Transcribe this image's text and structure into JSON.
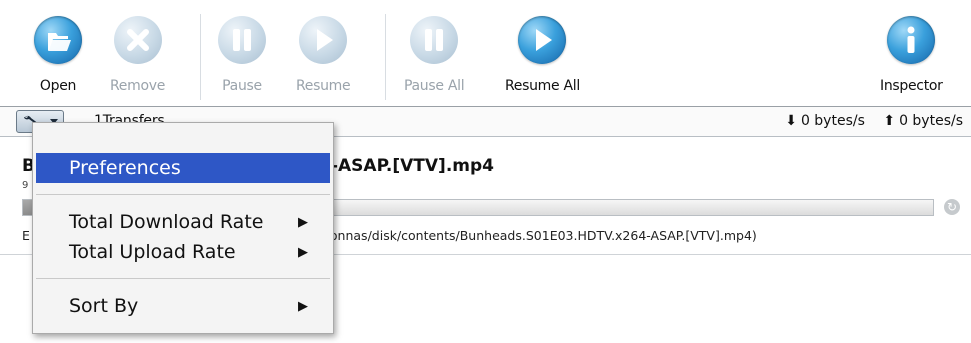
{
  "toolbar": {
    "open": "Open",
    "remove": "Remove",
    "pause": "Pause",
    "resume": "Resume",
    "pause_all": "Pause All",
    "resume_all": "Resume All",
    "inspector": "Inspector"
  },
  "icons": {
    "open": "folder-open-icon",
    "remove": "remove-x-icon",
    "pause": "pause-icon",
    "resume": "play-icon",
    "pause_all": "pause-icon",
    "resume_all": "play-icon",
    "inspector": "info-icon",
    "options": "wrench-icon",
    "download": "down-arrow-icon",
    "upload": "up-arrow-icon",
    "reload": "reload-icon"
  },
  "status": {
    "transfers": "1Transfers",
    "down_rate": "0 bytes/s",
    "up_rate": "0 bytes/s"
  },
  "transfer": {
    "title_prefix": "B",
    "title_suffix": "-ASAP.[VTV].mp4",
    "status_prefix": "9",
    "path_prefix": "E",
    "path_suffix": "onnas/disk/contents/Bunheads.S01E03.HDTV.x264-ASAP.[VTV].mp4)",
    "progress": 0.01
  },
  "menu": {
    "preferences": "Preferences",
    "total_download_rate": "Total Download Rate",
    "total_upload_rate": "Total Upload Rate",
    "sort_by": "Sort By"
  },
  "colors": {
    "accent_blue": "#2e57c6",
    "icon_blue": "#3aa0dc",
    "disabled_text": "#9aa3ab"
  }
}
